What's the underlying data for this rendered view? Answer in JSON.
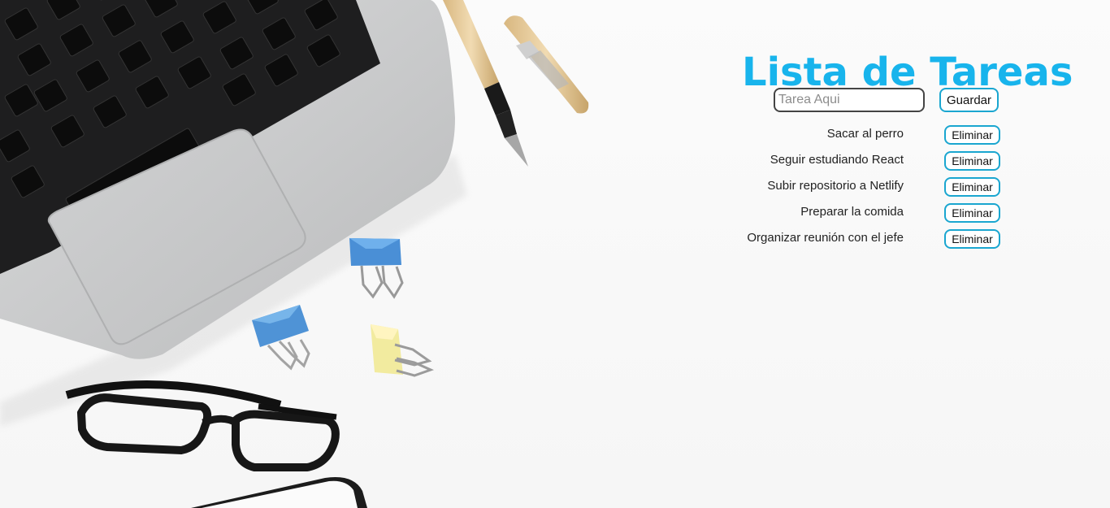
{
  "app": {
    "title": "Lista de Tareas"
  },
  "form": {
    "input_value": "",
    "input_placeholder": "Tarea Aqui",
    "save_label": "Guardar"
  },
  "tasks": [
    {
      "text": "Sacar al perro",
      "delete_label": "Eliminar"
    },
    {
      "text": "Seguir estudiando React",
      "delete_label": "Eliminar"
    },
    {
      "text": "Subir repositorio a Netlify",
      "delete_label": "Eliminar"
    },
    {
      "text": "Preparar la comida",
      "delete_label": "Eliminar"
    },
    {
      "text": "Organizar reunión con el jefe",
      "delete_label": "Eliminar"
    }
  ],
  "colors": {
    "title": "#18b4ec",
    "button_border": "#1aa6d0",
    "input_border": "#444444",
    "background": "#fafafa"
  }
}
